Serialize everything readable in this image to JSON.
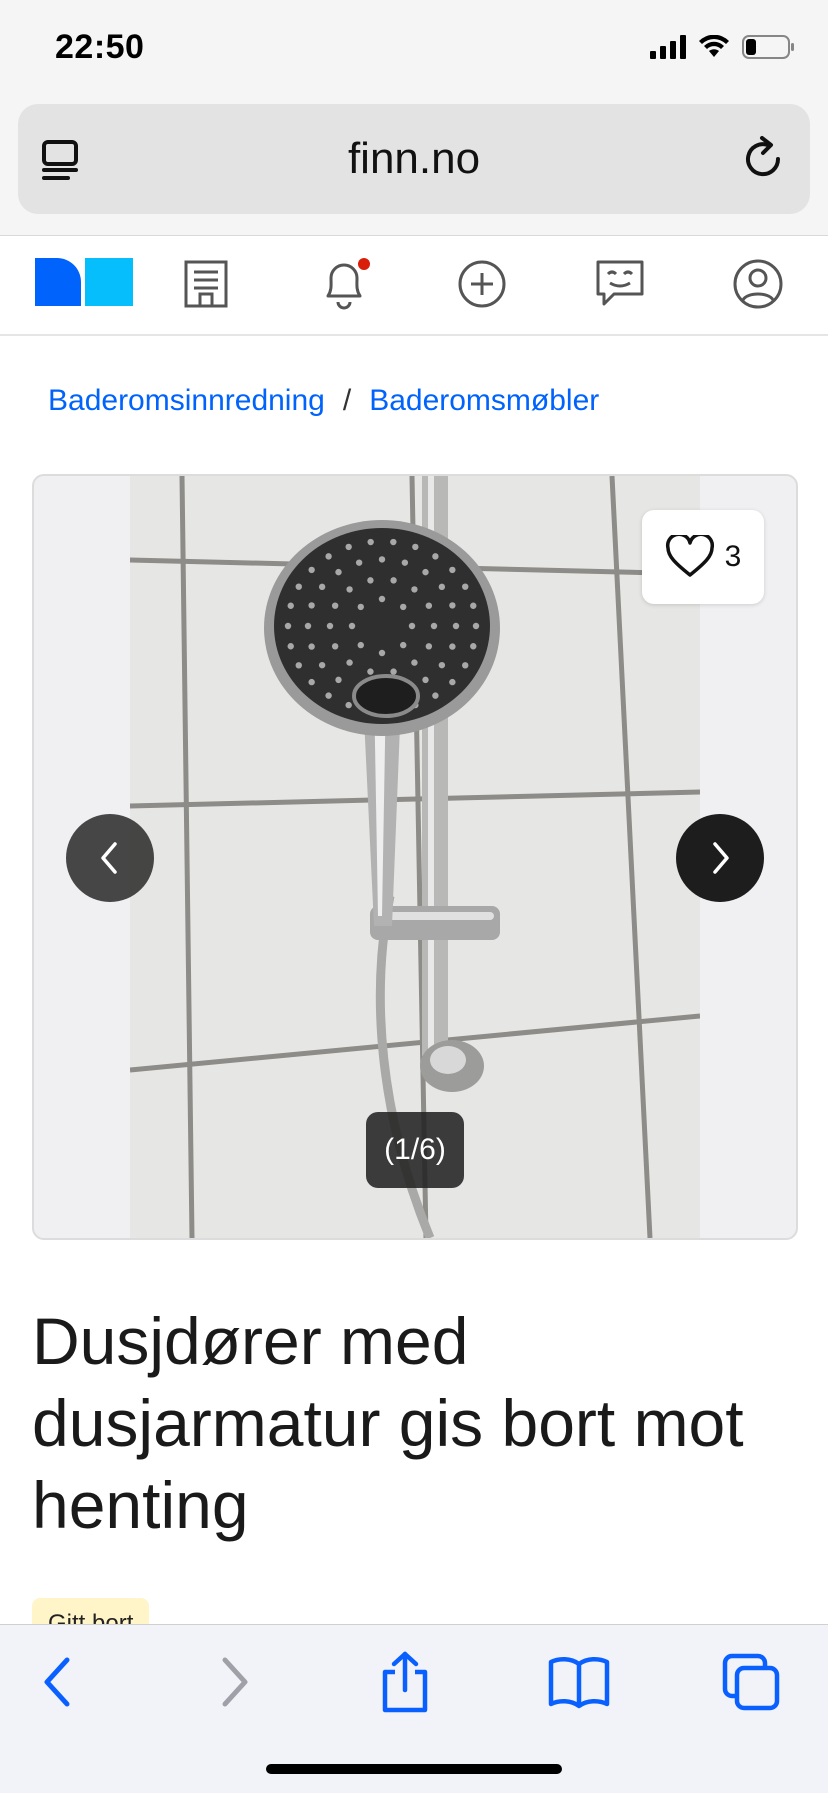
{
  "status_bar": {
    "time": "22:50",
    "icons": [
      "cellular-signal-icon",
      "wifi-icon",
      "battery-icon"
    ]
  },
  "browser": {
    "url": "finn.no",
    "icons": [
      "reader-view-icon",
      "reload-icon"
    ]
  },
  "site_nav": {
    "logo": "finn-logo",
    "items": [
      "company-building-icon",
      "notifications-bell-icon",
      "new-ad-plus-icon",
      "messages-icon",
      "profile-icon"
    ],
    "notification_dot_color": "#d91f0a"
  },
  "breadcrumb": {
    "items": [
      "Baderomsinnredning",
      "Baderomsmøbler"
    ],
    "separator": "/"
  },
  "gallery": {
    "favorite_count": "3",
    "image_counter": "(1/6)"
  },
  "ad": {
    "title": "Dusjdører med dusjarmatur gis bort mot henting",
    "status": "Gitt bort"
  },
  "toolbar": {
    "items": [
      "back-icon",
      "forward-icon",
      "share-icon",
      "bookmarks-icon",
      "tabs-icon"
    ]
  },
  "colors": {
    "link": "#0063fb",
    "toolbar_accent": "#0a60ff",
    "toolbar_disabled": "#a0a0a8",
    "badge_bg": "#fff5c8"
  }
}
